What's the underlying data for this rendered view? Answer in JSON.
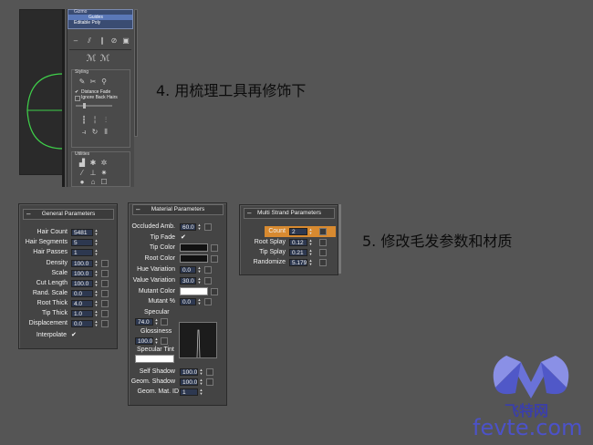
{
  "viewport_panel": {
    "stack_items": [
      "Gizmo",
      "Guides",
      "Editable Poly"
    ]
  },
  "styling": {
    "group_label": "Styling",
    "distance_fade": "Distance Fade",
    "ignore_back_hairs": "Ignore Back Hairs"
  },
  "utilities": {
    "group_label": "Utilities"
  },
  "caption1": "4. 用梳理工具再修饰下",
  "caption2": "5. 修改毛发参数和材质",
  "general": {
    "title": "General Parameters",
    "rows": [
      {
        "label": "Hair Count",
        "value": "5481"
      },
      {
        "label": "Hair Segments",
        "value": "5"
      },
      {
        "label": "Hair Passes",
        "value": "1"
      },
      {
        "label": "Density",
        "value": "100.0"
      },
      {
        "label": "Scale",
        "value": "100.0"
      },
      {
        "label": "Cut Length",
        "value": "100.0"
      },
      {
        "label": "Rand. Scale",
        "value": "0.0"
      },
      {
        "label": "Root Thick",
        "value": "4.0"
      },
      {
        "label": "Tip Thick",
        "value": "1.0"
      },
      {
        "label": "Displacement",
        "value": "0.0"
      }
    ],
    "interpolate_label": "Interpolate",
    "interpolate_check": "✔"
  },
  "material": {
    "title": "Material Parameters",
    "occluded_label": "Occluded Amb.",
    "occluded_value": "60.0",
    "tip_fade_label": "Tip Fade",
    "tip_fade_check": "✔",
    "tip_color_label": "Tip Color",
    "root_color_label": "Root Color",
    "hue_var_label": "Hue Variation",
    "hue_var_value": "0.0",
    "value_var_label": "Value Variation",
    "value_var_value": "30.0",
    "mutant_color_label": "Mutant Color",
    "mutant_pct_label": "Mutant %",
    "mutant_pct_value": "0.0",
    "specular_label": "Specular",
    "specular_value": "74.0",
    "glossiness_label": "Glossiness",
    "glossiness_value": "100.0",
    "specular_tint_label": "Specular Tint",
    "self_shadow_label": "Self Shadow",
    "self_shadow_value": "100.0",
    "geom_shadow_label": "Geom. Shadow",
    "geom_shadow_value": "100.0",
    "geom_mat_label": "Geom. Mat. ID",
    "geom_mat_value": "1",
    "colors": {
      "tip": "#111111",
      "root": "#111111",
      "mutant": "#ffffff",
      "spec_tint": "#ffffff"
    }
  },
  "multi": {
    "title": "Multi Strand Parameters",
    "rows": [
      {
        "label": "Count",
        "value": "2"
      },
      {
        "label": "Root Splay",
        "value": "0.12"
      },
      {
        "label": "Tip Splay",
        "value": "0.21"
      },
      {
        "label": "Randomize",
        "value": "5.179"
      }
    ],
    "highlight": "#d88a30"
  },
  "watermark": {
    "cn": "飞特网",
    "url": "fevte.com"
  }
}
